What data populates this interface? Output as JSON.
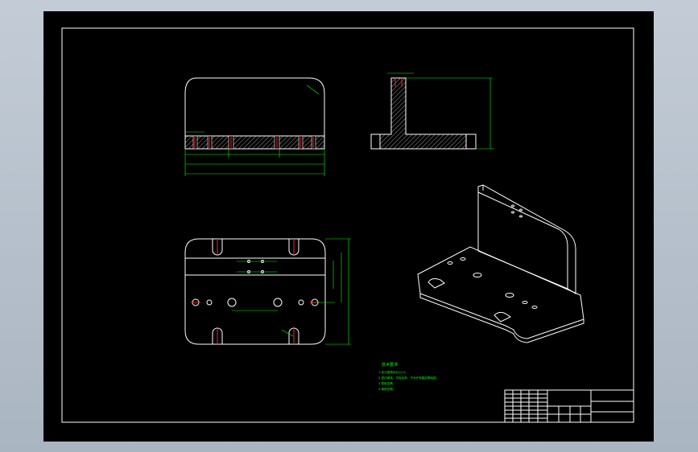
{
  "viewer": {
    "background": "#b7c1cd",
    "sheet_color": "#000000",
    "line_color": "#ffffff",
    "dimension_color": "#00ff00",
    "hidden_color": "#ff2020"
  },
  "drawing": {
    "views": [
      "front-section-view",
      "side-section-view",
      "top-view",
      "isometric-view"
    ],
    "technical_requirements": {
      "title": "技术要求",
      "lines": [
        "1.未注倒角均为C0.5。",
        "2.锐边倒钝，去除毛刺，不允许有裂纹等缺陷。",
        "3.表面发黑。",
        "4.调质处理。"
      ]
    }
  }
}
